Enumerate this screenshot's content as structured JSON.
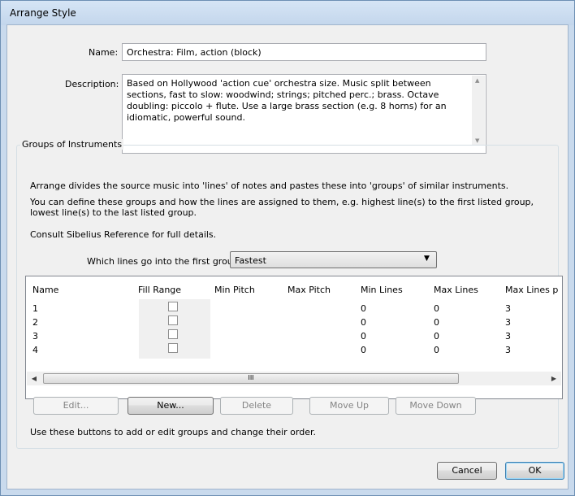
{
  "window": {
    "title": "Arrange Style"
  },
  "form": {
    "name_label": "Name:",
    "name_value": "Orchestra: Film, action (block)",
    "description_label": "Description:",
    "description_value": "Based on Hollywood 'action cue' orchestra size. Music split between sections, fast to slow: woodwind; strings; pitched perc.; brass. Octave doubling: piccolo + flute. Use a large brass section (e.g. 8 horns) for an idiomatic, powerful sound."
  },
  "groups": {
    "title": "Groups of Instruments",
    "text1": "Arrange divides the source music into 'lines' of notes and pastes these into 'groups' of similar instruments.",
    "text2": "You can define these groups and how the lines are assigned to them, e.g. highest line(s) to the first listed group, lowest line(s) to the last listed group.",
    "text3": "Consult Sibelius Reference for full details.",
    "which_lines_label": "Which lines go into the first group:",
    "which_lines_value": "Fastest",
    "table": {
      "headers": [
        "Name",
        "Fill Range",
        "Min Pitch",
        "Max Pitch",
        "Min Lines",
        "Max Lines",
        "Max Lines p"
      ],
      "rows": [
        {
          "name": "1",
          "fill_range": false,
          "min_pitch": "",
          "max_pitch": "",
          "min_lines": "0",
          "max_lines": "0",
          "max_lines_p": "3"
        },
        {
          "name": "2",
          "fill_range": false,
          "min_pitch": "",
          "max_pitch": "",
          "min_lines": "0",
          "max_lines": "0",
          "max_lines_p": "3"
        },
        {
          "name": "3",
          "fill_range": false,
          "min_pitch": "",
          "max_pitch": "",
          "min_lines": "0",
          "max_lines": "0",
          "max_lines_p": "3"
        },
        {
          "name": "4",
          "fill_range": false,
          "min_pitch": "",
          "max_pitch": "",
          "min_lines": "0",
          "max_lines": "0",
          "max_lines_p": "3"
        }
      ],
      "scroll_grip": "III"
    },
    "buttons": {
      "edit": "Edit...",
      "new": "New...",
      "delete": "Delete",
      "move_up": "Move Up",
      "move_down": "Move Down"
    },
    "hint": "Use these buttons to add or edit groups and change their order."
  },
  "dialog_buttons": {
    "cancel": "Cancel",
    "ok": "OK"
  }
}
